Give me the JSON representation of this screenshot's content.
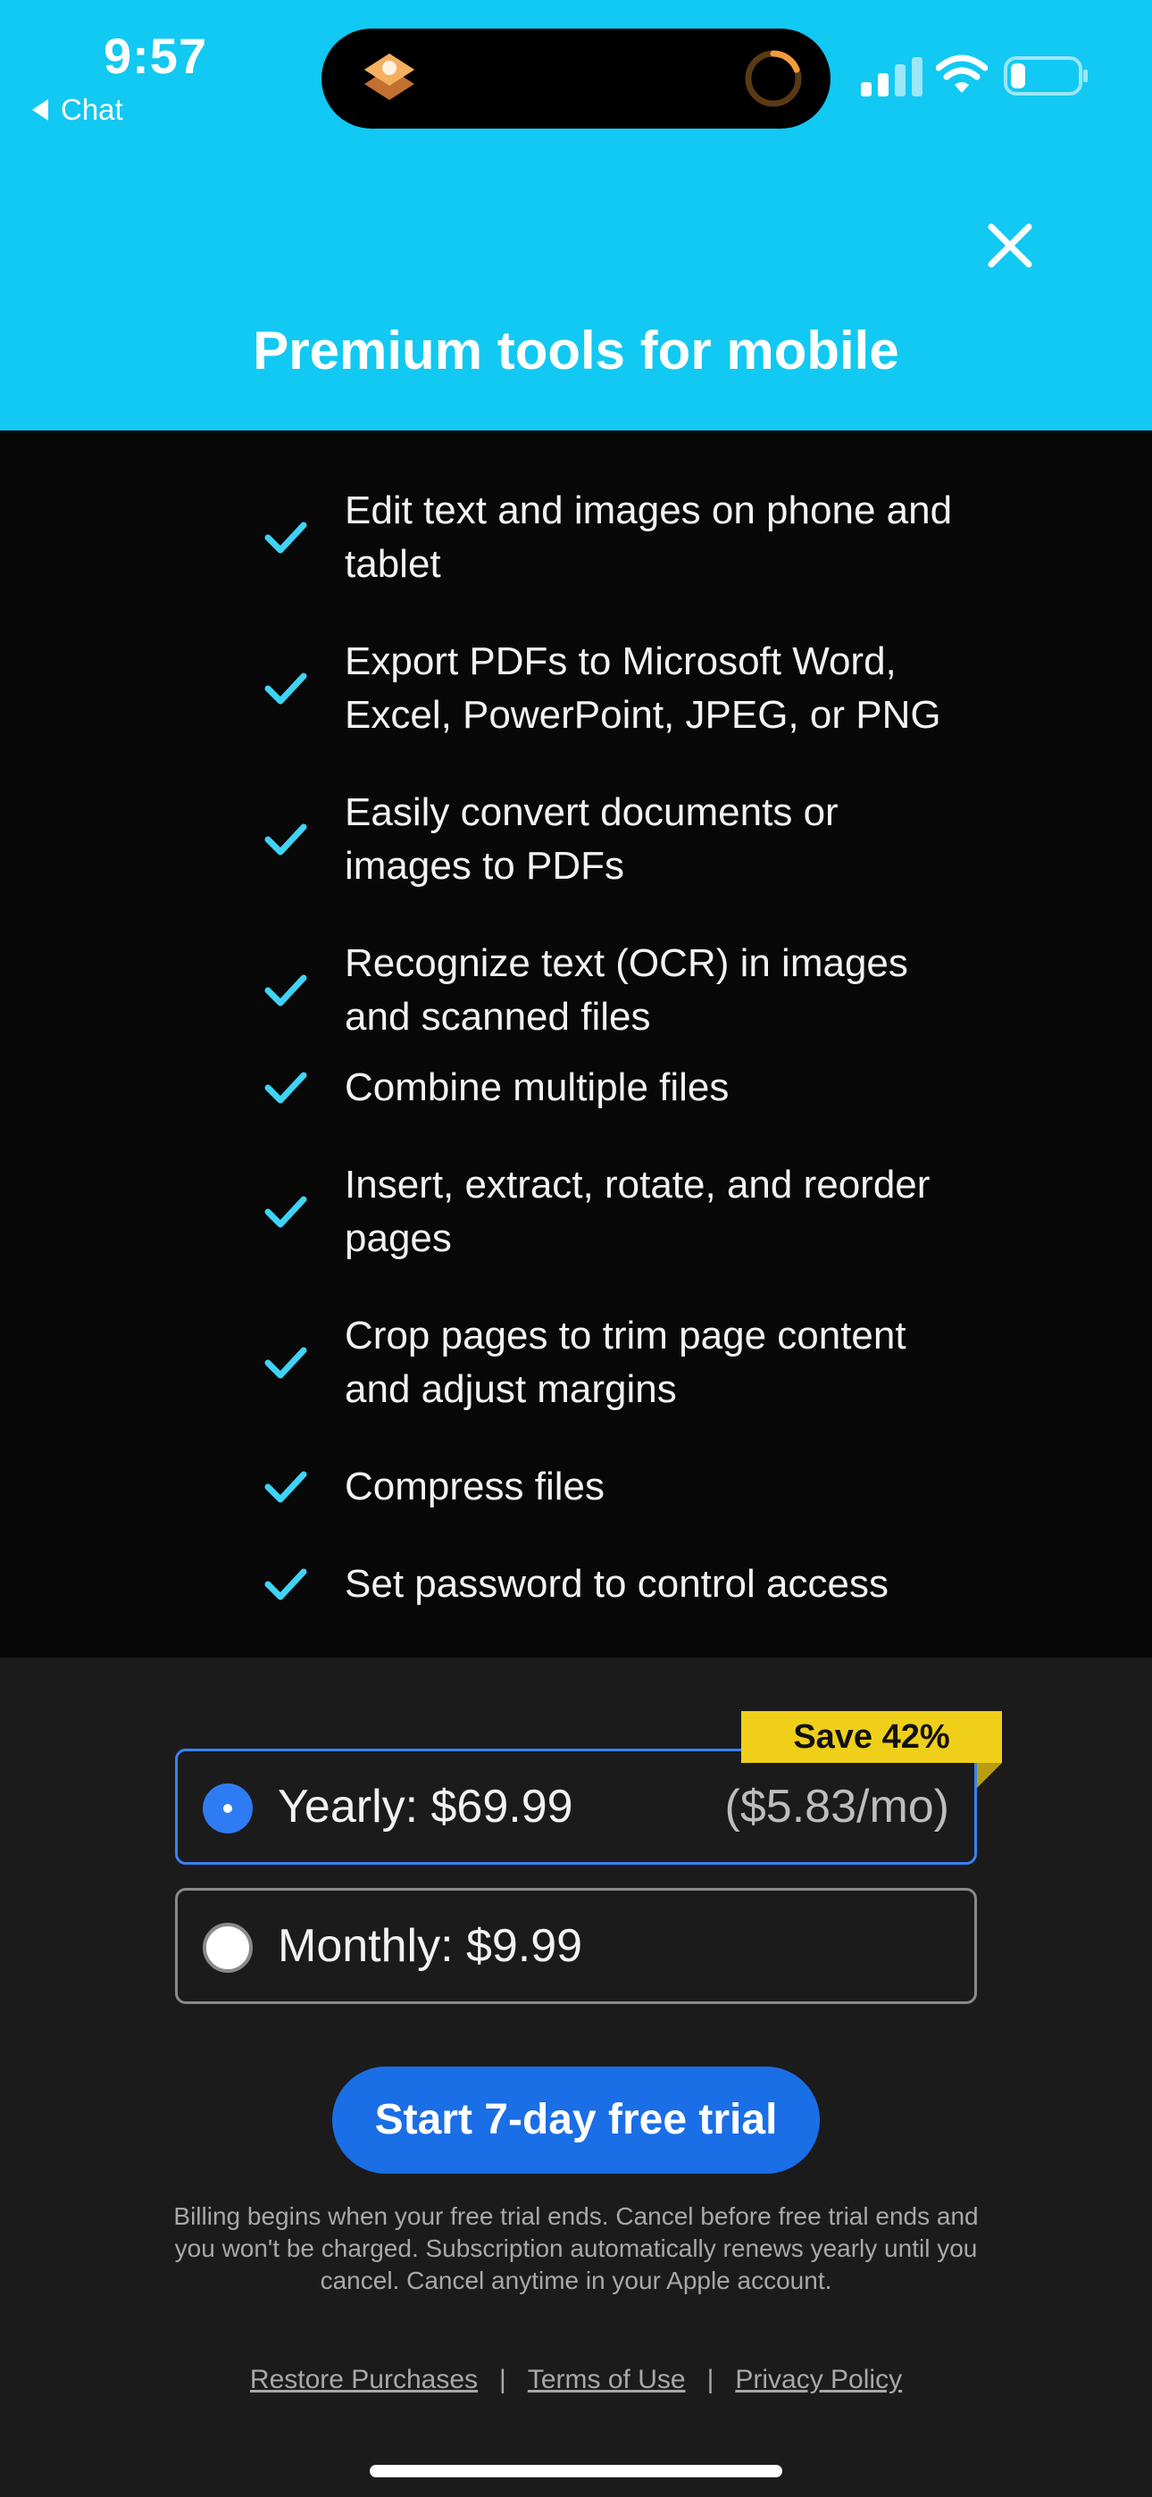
{
  "status_bar": {
    "time": "9:57",
    "back_label": "Chat",
    "icons": [
      "app-icon",
      "progress-ring-icon",
      "signal-icon",
      "wifi-icon",
      "battery-icon"
    ]
  },
  "header": {
    "title": "Premium tools for mobile",
    "close_icon": "close-icon",
    "background": "#11c9f2"
  },
  "features": [
    {
      "text": "Edit text and images on phone and tablet"
    },
    {
      "text": "Export PDFs to Microsoft Word, Excel, PowerPoint, JPEG, or PNG"
    },
    {
      "text": "Easily convert documents or images to PDFs"
    },
    {
      "text": "Recognize text (OCR) in images and scanned files"
    },
    {
      "text": "Combine multiple files"
    },
    {
      "text": "Insert, extract, rotate, and reorder pages"
    },
    {
      "text": "Crop pages to trim page content and adjust margins"
    },
    {
      "text": "Compress files"
    },
    {
      "text": "Set password to control access"
    }
  ],
  "plans": {
    "badge": "Save 42%",
    "yearly": {
      "label": "Yearly: $69.99",
      "sub": "($5.83/mo)",
      "selected": true
    },
    "monthly": {
      "label": "Monthly: $9.99",
      "selected": false
    }
  },
  "cta": {
    "label": "Start 7-day free trial"
  },
  "disclaimer": "Billing begins when your free trial ends. Cancel before free trial ends and you won't be charged. Subscription automatically renews yearly until you cancel. Cancel anytime in your Apple account.",
  "footer": {
    "restore": "Restore Purchases",
    "terms": "Terms of Use",
    "privacy": "Privacy Policy",
    "separator": "|"
  },
  "colors": {
    "accent": "#1a6ee6",
    "check": "#3fd3f5",
    "badge": "#f0cf1a"
  }
}
